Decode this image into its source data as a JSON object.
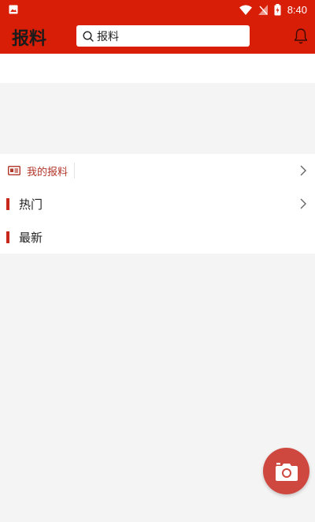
{
  "status_bar": {
    "time": "8:40"
  },
  "app_bar": {
    "title": "报料",
    "search_value": "报料"
  },
  "sections": {
    "mine_label": "我的报料",
    "hot_label": "热门",
    "latest_label": "最新"
  },
  "colors": {
    "brand_red": "#d81e06",
    "accent_red": "#c8281c",
    "fab_red": "#cf4840"
  },
  "icons": {
    "status_left": "image-icon",
    "wifi": "wifi-icon",
    "signal": "signal-icon",
    "battery": "battery-icon",
    "search": "search-icon",
    "bell": "bell-icon",
    "mine": "newspaper-icon",
    "chevron": "chevron-right-icon",
    "fab": "camera-icon"
  }
}
